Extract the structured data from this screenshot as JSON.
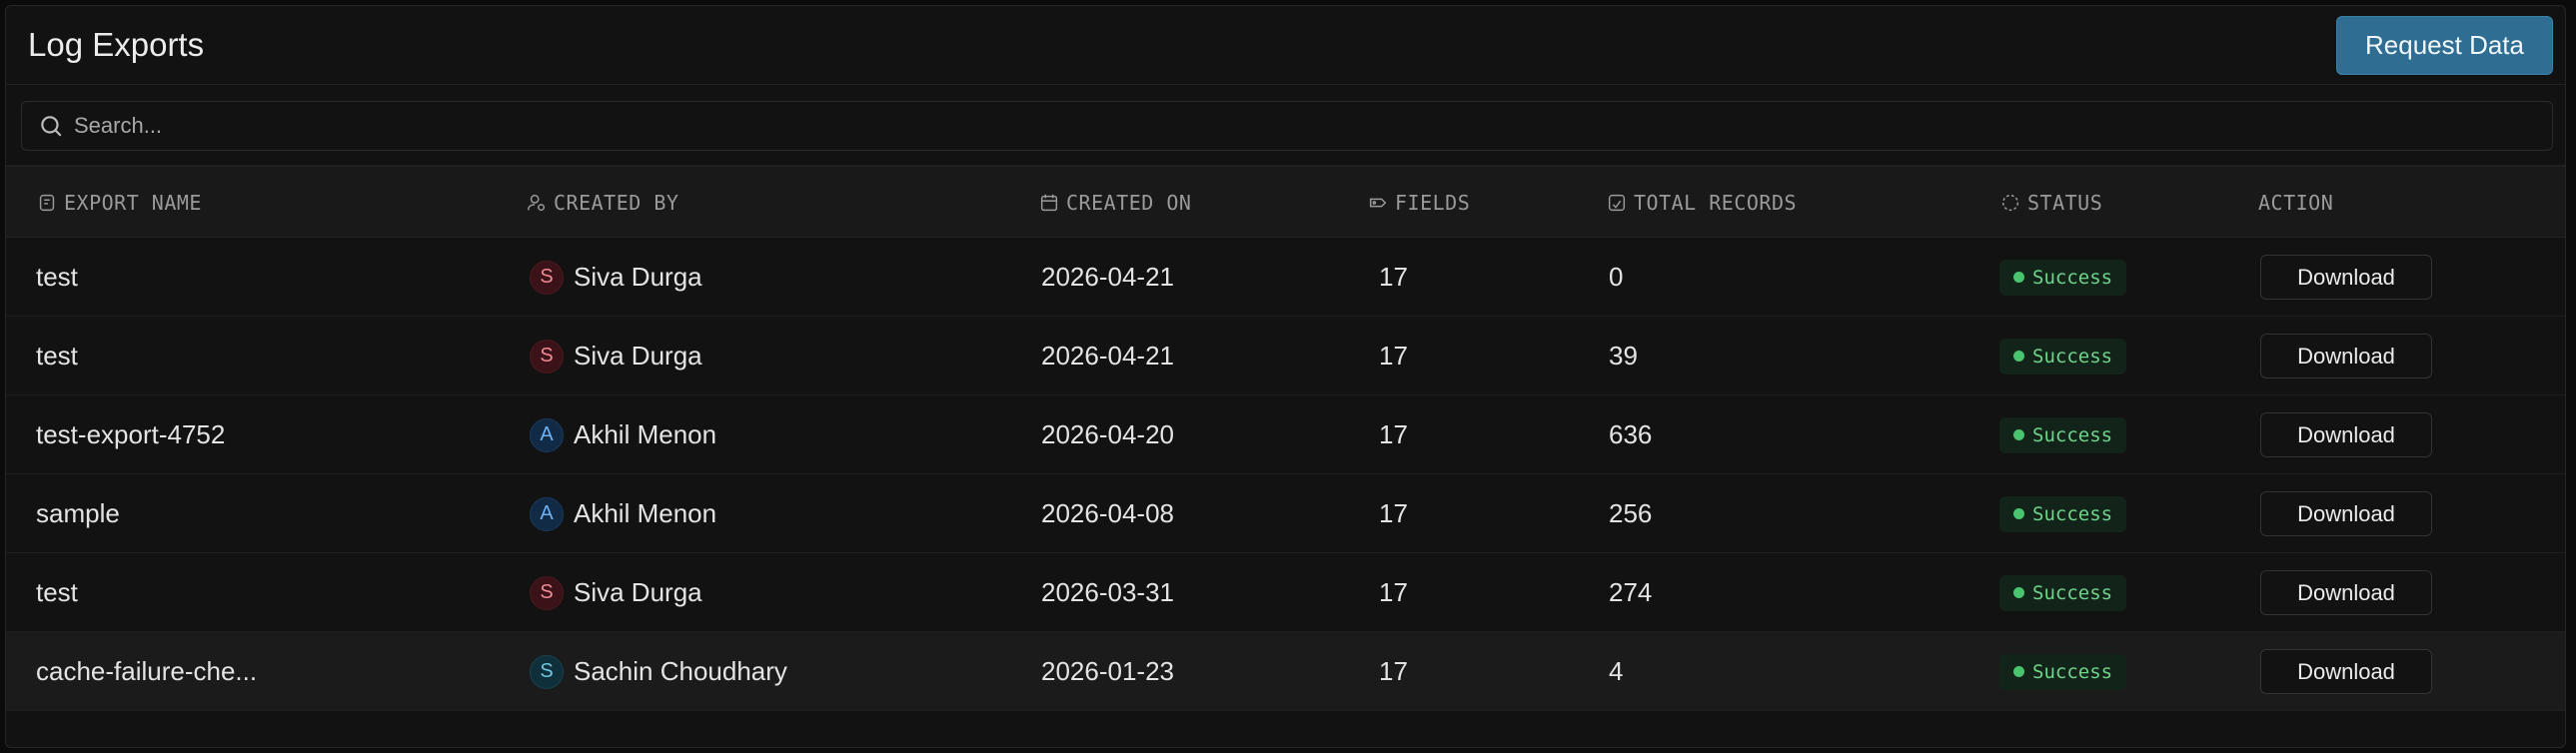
{
  "header": {
    "title": "Log Exports",
    "request_label": "Request Data"
  },
  "search": {
    "placeholder": "Search..."
  },
  "columns": {
    "export_name": "EXPORT NAME",
    "created_by": "CREATED BY",
    "created_on": "CREATED ON",
    "fields": "FIELDS",
    "total_records": "TOTAL RECORDS",
    "status": "STATUS",
    "action": "ACTION"
  },
  "rows": [
    {
      "name": "test",
      "initial": "S",
      "user": "Siva Durga",
      "date": "2026-04-21",
      "fields": "17",
      "records": "0",
      "status": "Success",
      "action": "Download"
    },
    {
      "name": "test",
      "initial": "S",
      "user": "Siva Durga",
      "date": "2026-04-21",
      "fields": "17",
      "records": "39",
      "status": "Success",
      "action": "Download"
    },
    {
      "name": "test-export-4752",
      "initial": "A",
      "user": "Akhil Menon",
      "date": "2026-04-20",
      "fields": "17",
      "records": "636",
      "status": "Success",
      "action": "Download"
    },
    {
      "name": "sample",
      "initial": "A",
      "user": "Akhil Menon",
      "date": "2026-04-08",
      "fields": "17",
      "records": "256",
      "status": "Success",
      "action": "Download"
    },
    {
      "name": "test",
      "initial": "S",
      "user": "Siva Durga",
      "date": "2026-03-31",
      "fields": "17",
      "records": "274",
      "status": "Success",
      "action": "Download"
    },
    {
      "name": "cache-failure-che...",
      "initial": "S",
      "user": "Sachin Choudhary",
      "date": "2026-01-23",
      "fields": "17",
      "records": "4",
      "status": "Success",
      "action": "Download"
    }
  ],
  "colors": {
    "accent": "#2f6e92",
    "success": "#4ac46f",
    "avatar_siva": "#3a1217",
    "avatar_akhil": "#112a46",
    "avatar_sachin": "#0f2f3a"
  }
}
